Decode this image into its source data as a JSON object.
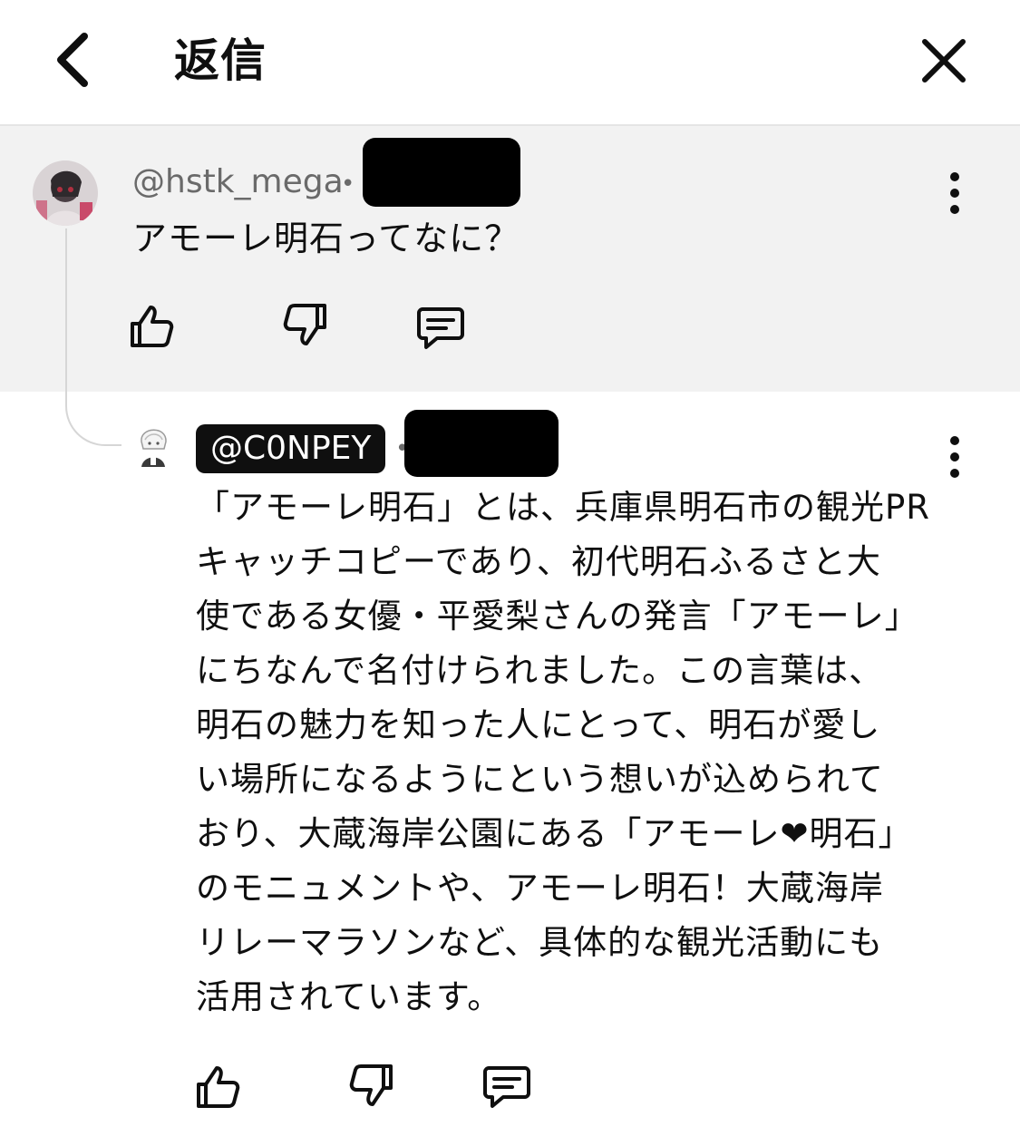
{
  "header": {
    "title": "返信",
    "back_icon": "chevron-left-icon",
    "close_icon": "close-icon"
  },
  "parent_comment": {
    "handle": "@hstk_mega",
    "separator": "•",
    "text": "アモーレ明石ってなに？",
    "actions": [
      "like-icon",
      "dislike-icon",
      "reply-icon"
    ]
  },
  "reply_comment": {
    "handle": "@C0NPEY",
    "separator": "•",
    "lines": [
      "「アモーレ明石」とは、兵庫県明石市の観光PR",
      "キャッチコピーであり、初代明石ふるさと大",
      "使である女優・平愛梨さんの発言「アモーレ」",
      "にちなんで名付けられました。この言葉は、",
      "明石の魅力を知った人にとって、明石が愛し",
      "い場所になるようにという想いが込められて",
      "おり、大蔵海岸公園にある「アモーレ❤明石」",
      "のモニュメントや、アモーレ明石！大蔵海岸",
      "リレーマラソンなど、具体的な観光活動にも",
      "活用されています。"
    ],
    "actions": [
      "like-icon",
      "dislike-icon",
      "reply-icon"
    ]
  },
  "colors": {
    "parent_background": "#f2f2f2",
    "text": "#0f0f0f",
    "secondary_text": "#6a6a6a",
    "handle_badge": "#0f0f0f",
    "redaction": "#000000"
  }
}
